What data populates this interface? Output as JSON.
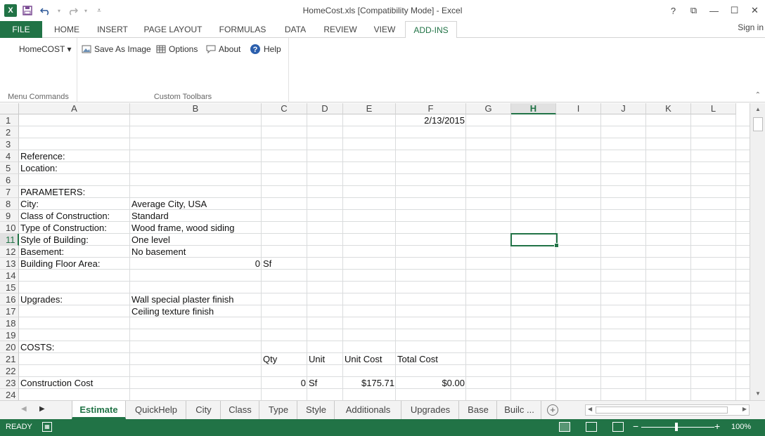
{
  "window": {
    "title": "HomeCost.xls  [Compatibility Mode] - Excel",
    "controls": [
      "?",
      "⧉",
      "—",
      "☐",
      "✕"
    ]
  },
  "quick_access": {
    "app_icon": "X",
    "icons": [
      "save-icon",
      "undo-icon",
      "redo-icon",
      "customize-icon"
    ]
  },
  "ribbon_tabs": [
    "FILE",
    "HOME",
    "INSERT",
    "PAGE LAYOUT",
    "FORMULAS",
    "DATA",
    "REVIEW",
    "VIEW",
    "ADD-INS"
  ],
  "active_tab": "ADD-INS",
  "sign_in": "Sign in",
  "ribbon": {
    "menu_commands": {
      "button": "HomeCOST ▾",
      "label": "Menu Commands"
    },
    "custom_toolbars": {
      "buttons": [
        "Save As Image",
        "Options",
        "About",
        "Help"
      ],
      "label": "Custom Toolbars"
    }
  },
  "columns": [
    "A",
    "B",
    "C",
    "D",
    "E",
    "F",
    "G",
    "H",
    "I",
    "J",
    "K",
    "L"
  ],
  "selected_column": "H",
  "rows": [
    "1",
    "2",
    "3",
    "4",
    "5",
    "6",
    "7",
    "8",
    "9",
    "10",
    "11",
    "12",
    "13",
    "14",
    "15",
    "16",
    "17",
    "18",
    "19",
    "20",
    "21",
    "22",
    "23",
    "24"
  ],
  "selected_row": "11",
  "cells": {
    "F1": "2/13/2015",
    "A4": "Reference:",
    "A5": "Location:",
    "A7": "PARAMETERS:",
    "A8": "City:",
    "B8": "Average City, USA",
    "A9": "Class of Construction:",
    "B9": "Standard",
    "A10": "Type of Construction:",
    "B10": "Wood frame, wood siding",
    "A11": "Style of Building:",
    "B11": "One level",
    "A12": "Basement:",
    "B12": "No basement",
    "A13": "Building Floor Area:",
    "B13": "0",
    "C13": "Sf",
    "A16": "Upgrades:",
    "B16": "Wall special plaster finish",
    "B17": "Ceiling texture finish",
    "A20": "COSTS:",
    "C21": "Qty",
    "D21": "Unit",
    "E21": "Unit Cost",
    "F21": "Total Cost",
    "A23": "Construction Cost",
    "C23": "0",
    "D23": "Sf",
    "E23": "$175.71",
    "F23": "$0.00"
  },
  "sheet_tabs": [
    "Estimate",
    "QuickHelp",
    "City",
    "Class",
    "Type",
    "Style",
    "Additionals",
    "Upgrades",
    "Base",
    "Builc ..."
  ],
  "active_sheet": "Estimate",
  "status": {
    "ready": "READY",
    "zoom": "100%"
  },
  "colors": {
    "excel_green": "#217346"
  }
}
